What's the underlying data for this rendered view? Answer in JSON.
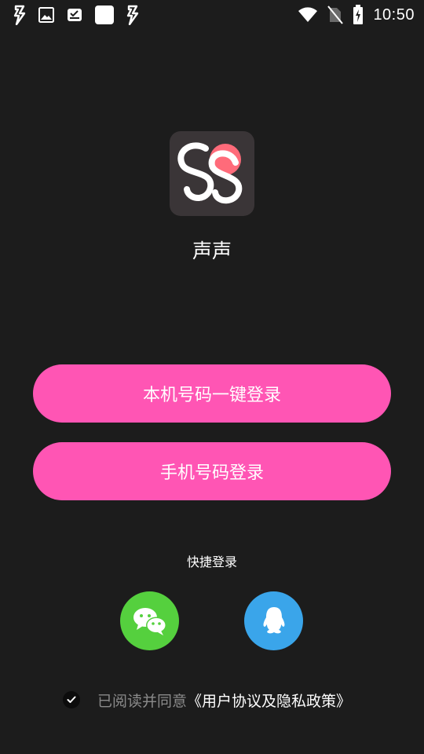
{
  "status_bar": {
    "time": "10:50",
    "left_icons": [
      "bolt-icon",
      "image-icon",
      "weather-icon",
      "blank-square-icon",
      "bolt-icon"
    ],
    "right_icons": [
      "wifi-icon",
      "no-sim-icon",
      "battery-charging-icon"
    ]
  },
  "app": {
    "name": "声声",
    "logo_bg": "#3a3537",
    "logo_accent": "#ff6b7a"
  },
  "buttons": {
    "one_key_login": "本机号码一键登录",
    "phone_login": "手机号码登录",
    "color": "#ff55b4"
  },
  "quick_login": {
    "title": "快捷登录",
    "wechat_icon": "wechat-icon",
    "wechat_color": "#55d03e",
    "qq_icon": "qq-icon",
    "qq_color": "#3aa5ea"
  },
  "agreement": {
    "checked": true,
    "prefix": "已阅读并同意",
    "link": "《用户协议及隐私政策》"
  }
}
